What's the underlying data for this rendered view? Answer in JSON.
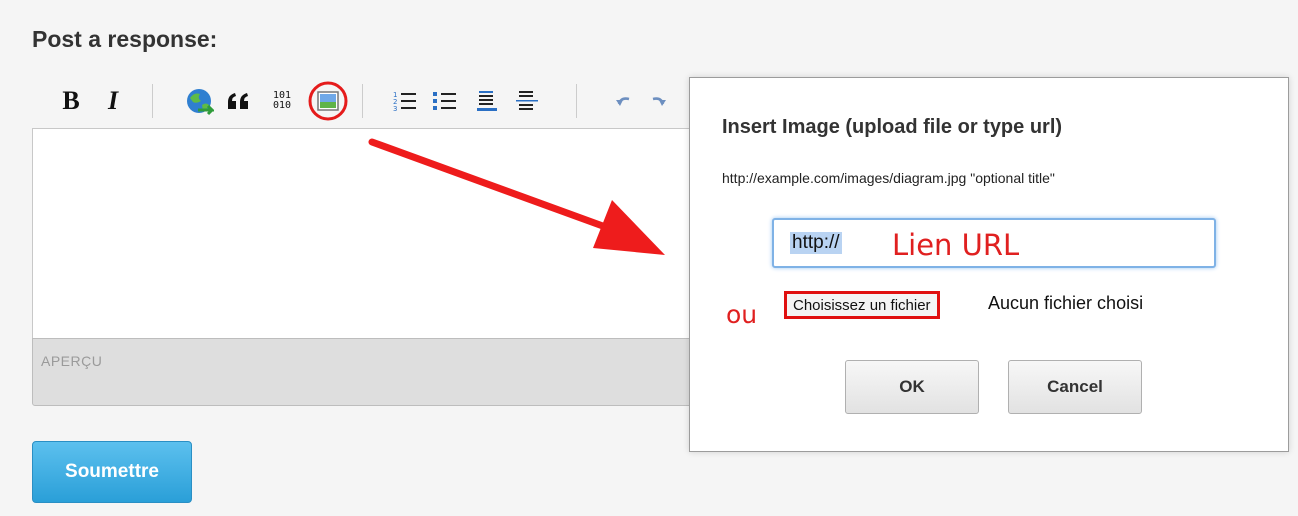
{
  "form": {
    "heading": "Post a response:",
    "preview_label": "APERÇU",
    "submit_label": "Soumettre"
  },
  "toolbar": {
    "bold_label": "B",
    "italic_label": "I",
    "code_label_top": "101",
    "code_label_bottom": "010",
    "icons": [
      "bold-icon",
      "italic-icon",
      "link-globe-icon",
      "blockquote-icon",
      "code-icon",
      "image-icon",
      "ordered-list-icon",
      "bulleted-list-icon",
      "heading-icon",
      "horizontal-rule-icon",
      "undo-icon",
      "redo-icon"
    ]
  },
  "dialog": {
    "title": "Insert Image (upload file or type url)",
    "hint": "http://example.com/images/diagram.jpg \"optional title\"",
    "url_value": "http://",
    "file_button_label": "Choisissez un fichier",
    "file_status": "Aucun fichier choisi",
    "ok_label": "OK",
    "cancel_label": "Cancel"
  },
  "annotations": {
    "url_label": "Lien URL",
    "or_label": "ou",
    "color": "#e02020"
  }
}
